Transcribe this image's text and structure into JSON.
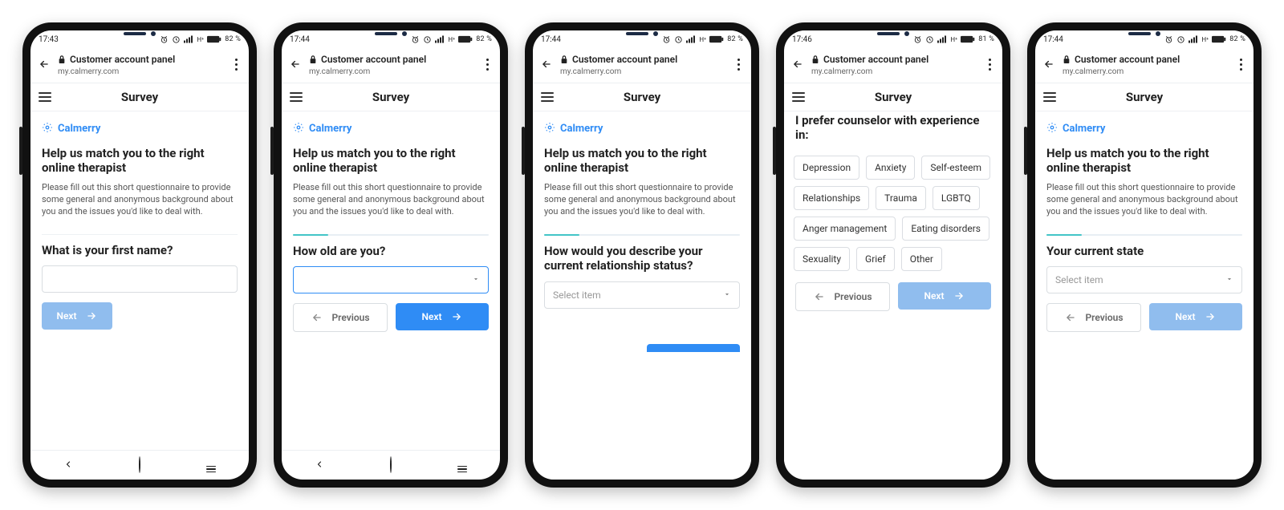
{
  "browser": {
    "page_title": "Customer account panel",
    "host": "my.calmerry.com"
  },
  "brand": {
    "name": "Calmerry"
  },
  "header": {
    "title": "Survey"
  },
  "intro": {
    "heading": "Help us match you to the right online therapist",
    "body": "Please fill out this short questionnaire to provide some general and anonymous background about you and the issues you'd like to deal with."
  },
  "buttons": {
    "next": "Next",
    "previous": "Previous"
  },
  "select_placeholder": "Select item",
  "screens": [
    {
      "status_time": "17:43",
      "battery": "82 %",
      "question": "What is your first name?",
      "show_brand": true,
      "show_intro": true,
      "has_navbar": true,
      "has_progress": false,
      "has_divider": true,
      "control": "text",
      "has_previous": false,
      "next_faded": true
    },
    {
      "status_time": "17:44",
      "battery": "82 %",
      "question": "How old are you?",
      "show_brand": true,
      "show_intro": true,
      "has_navbar": true,
      "has_progress": true,
      "has_divider": false,
      "control": "select_focused",
      "has_previous": true,
      "next_faded": false
    },
    {
      "status_time": "17:44",
      "battery": "82 %",
      "question": "How would you describe your current relationship status?",
      "show_brand": true,
      "show_intro": true,
      "has_navbar": false,
      "has_progress": true,
      "has_divider": false,
      "control": "select",
      "has_previous": false,
      "next_faded": false,
      "footer": "partial"
    },
    {
      "status_time": "17:46",
      "battery": "81 %",
      "question": "I prefer counselor with experience in:",
      "show_brand": false,
      "show_intro": false,
      "has_navbar": false,
      "has_progress": false,
      "has_divider": false,
      "control": "chips",
      "chips": [
        "Depression",
        "Anxiety",
        "Self-esteem",
        "Relationships",
        "Trauma",
        "LGBTQ",
        "Anger management",
        "Eating disorders",
        "Sexuality",
        "Grief",
        "Other"
      ],
      "has_previous": true,
      "next_faded": true
    },
    {
      "status_time": "17:44",
      "battery": "82 %",
      "question": "Your current state",
      "show_brand": true,
      "show_intro": true,
      "has_navbar": false,
      "has_progress": true,
      "has_divider": false,
      "control": "select",
      "has_previous": true,
      "next_faded": true
    }
  ]
}
